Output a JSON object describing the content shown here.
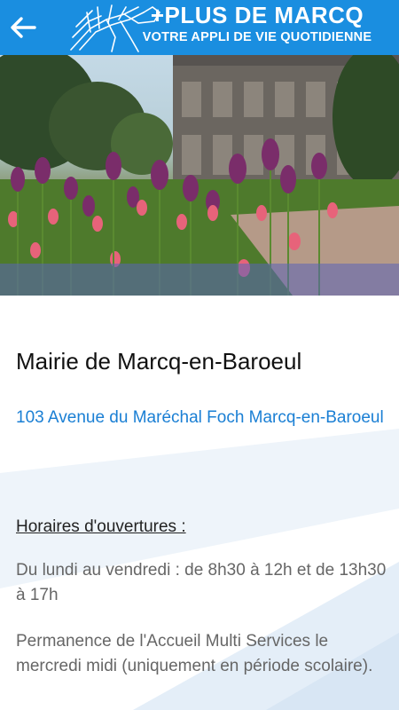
{
  "header": {
    "brand_title": "+PLUS DE MARCQ",
    "brand_subtitle": "VOTRE APPLI DE VIE QUOTIDIENNE",
    "back_icon": "arrow-left-icon",
    "logo_icon": "horse-logo-icon",
    "color": "#1a8ee0"
  },
  "place": {
    "name": "Mairie de Marcq-en-Baroeul",
    "address": "103 Avenue du Maréchal Foch Marcq-en-Baroeul",
    "hours_heading": "Horaires d'ouvertures :",
    "hours": "Du lundi au vendredi : de 8h30 à 12h et de 13h30 à 17h",
    "permanence": "Permanence de l'Accueil Multi Services le mercredi midi (uniquement en période scolaire).",
    "link_color": "#1a7fd4"
  }
}
